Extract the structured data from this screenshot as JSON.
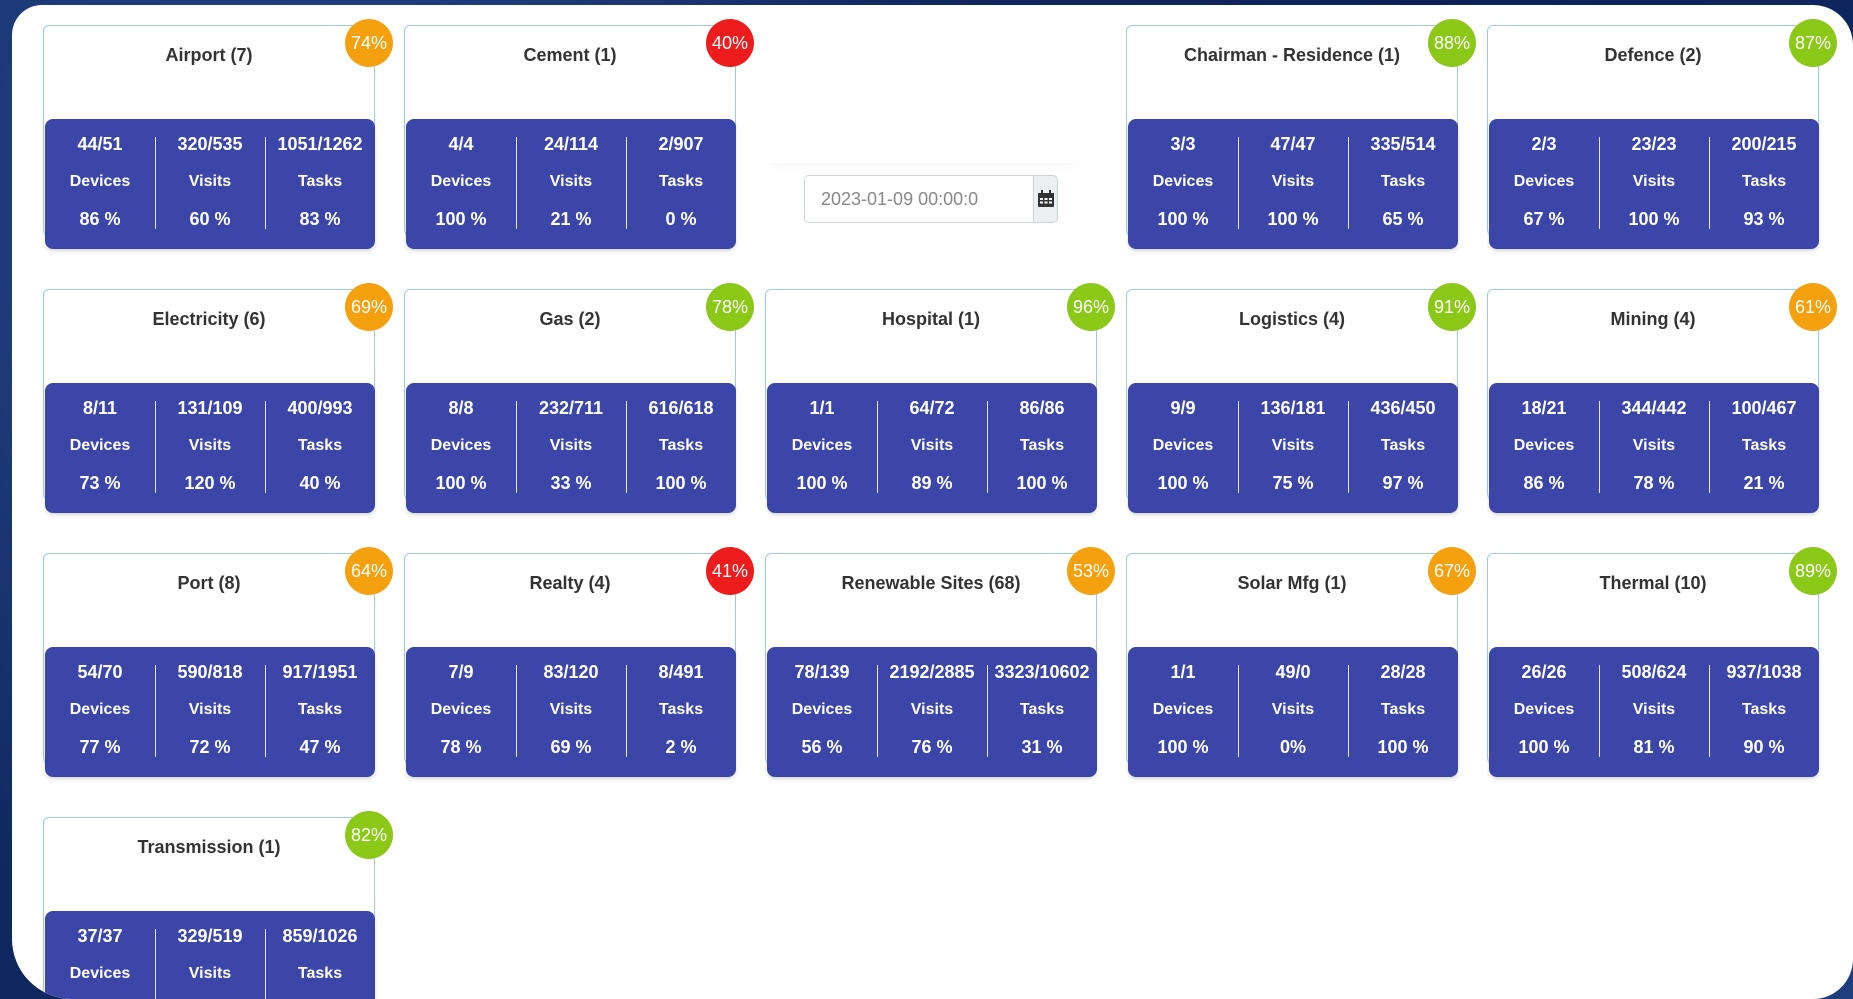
{
  "date_picker": {
    "value": "2023-01-09 00:00:0",
    "icon": "calendar-icon"
  },
  "badge_colors": {
    "orange": "#f5a10f",
    "red": "#ee1c1c",
    "green": "#8cc817"
  },
  "cards": [
    {
      "title": "Airport (7)",
      "badge": "74%",
      "badge_color": "orange",
      "stats": [
        {
          "value": "44/51",
          "label": "Devices",
          "pct": "86 %"
        },
        {
          "value": "320/535",
          "label": "Visits",
          "pct": "60 %"
        },
        {
          "value": "1051/1262",
          "label": "Tasks",
          "pct": "83 %"
        }
      ]
    },
    {
      "title": "Cement (1)",
      "badge": "40%",
      "badge_color": "red",
      "stats": [
        {
          "value": "4/4",
          "label": "Devices",
          "pct": "100 %"
        },
        {
          "value": "24/114",
          "label": "Visits",
          "pct": "21 %"
        },
        {
          "value": "2/907",
          "label": "Tasks",
          "pct": "0 %"
        }
      ]
    },
    {
      "title": "Chairman - Residence (1)",
      "badge": "88%",
      "badge_color": "green",
      "stats": [
        {
          "value": "3/3",
          "label": "Devices",
          "pct": "100 %"
        },
        {
          "value": "47/47",
          "label": "Visits",
          "pct": "100 %"
        },
        {
          "value": "335/514",
          "label": "Tasks",
          "pct": "65 %"
        }
      ]
    },
    {
      "title": "Defence (2)",
      "badge": "87%",
      "badge_color": "green",
      "stats": [
        {
          "value": "2/3",
          "label": "Devices",
          "pct": "67 %"
        },
        {
          "value": "23/23",
          "label": "Visits",
          "pct": "100 %"
        },
        {
          "value": "200/215",
          "label": "Tasks",
          "pct": "93 %"
        }
      ]
    },
    {
      "title": "Electricity (6)",
      "badge": "69%",
      "badge_color": "orange",
      "stats": [
        {
          "value": "8/11",
          "label": "Devices",
          "pct": "73 %"
        },
        {
          "value": "131/109",
          "label": "Visits",
          "pct": "120 %"
        },
        {
          "value": "400/993",
          "label": "Tasks",
          "pct": "40 %"
        }
      ]
    },
    {
      "title": "Gas (2)",
      "badge": "78%",
      "badge_color": "green",
      "stats": [
        {
          "value": "8/8",
          "label": "Devices",
          "pct": "100 %"
        },
        {
          "value": "232/711",
          "label": "Visits",
          "pct": "33 %"
        },
        {
          "value": "616/618",
          "label": "Tasks",
          "pct": "100 %"
        }
      ]
    },
    {
      "title": "Hospital (1)",
      "badge": "96%",
      "badge_color": "green",
      "stats": [
        {
          "value": "1/1",
          "label": "Devices",
          "pct": "100 %"
        },
        {
          "value": "64/72",
          "label": "Visits",
          "pct": "89 %"
        },
        {
          "value": "86/86",
          "label": "Tasks",
          "pct": "100 %"
        }
      ]
    },
    {
      "title": "Logistics (4)",
      "badge": "91%",
      "badge_color": "green",
      "stats": [
        {
          "value": "9/9",
          "label": "Devices",
          "pct": "100 %"
        },
        {
          "value": "136/181",
          "label": "Visits",
          "pct": "75 %"
        },
        {
          "value": "436/450",
          "label": "Tasks",
          "pct": "97 %"
        }
      ]
    },
    {
      "title": "Mining (4)",
      "badge": "61%",
      "badge_color": "orange",
      "stats": [
        {
          "value": "18/21",
          "label": "Devices",
          "pct": "86 %"
        },
        {
          "value": "344/442",
          "label": "Visits",
          "pct": "78 %"
        },
        {
          "value": "100/467",
          "label": "Tasks",
          "pct": "21 %"
        }
      ]
    },
    {
      "title": "Port (8)",
      "badge": "64%",
      "badge_color": "orange",
      "stats": [
        {
          "value": "54/70",
          "label": "Devices",
          "pct": "77 %"
        },
        {
          "value": "590/818",
          "label": "Visits",
          "pct": "72 %"
        },
        {
          "value": "917/1951",
          "label": "Tasks",
          "pct": "47 %"
        }
      ]
    },
    {
      "title": "Realty (4)",
      "badge": "41%",
      "badge_color": "red",
      "stats": [
        {
          "value": "7/9",
          "label": "Devices",
          "pct": "78 %"
        },
        {
          "value": "83/120",
          "label": "Visits",
          "pct": "69 %"
        },
        {
          "value": "8/491",
          "label": "Tasks",
          "pct": "2 %"
        }
      ]
    },
    {
      "title": "Renewable Sites (68)",
      "badge": "53%",
      "badge_color": "orange",
      "stats": [
        {
          "value": "78/139",
          "label": "Devices",
          "pct": "56 %"
        },
        {
          "value": "2192/2885",
          "label": "Visits",
          "pct": "76 %"
        },
        {
          "value": "3323/10602",
          "label": "Tasks",
          "pct": "31 %"
        }
      ]
    },
    {
      "title": "Solar Mfg (1)",
      "badge": "67%",
      "badge_color": "orange",
      "stats": [
        {
          "value": "1/1",
          "label": "Devices",
          "pct": "100 %"
        },
        {
          "value": "49/0",
          "label": "Visits",
          "pct": "0%"
        },
        {
          "value": "28/28",
          "label": "Tasks",
          "pct": "100 %"
        }
      ]
    },
    {
      "title": "Thermal (10)",
      "badge": "89%",
      "badge_color": "green",
      "stats": [
        {
          "value": "26/26",
          "label": "Devices",
          "pct": "100 %"
        },
        {
          "value": "508/624",
          "label": "Visits",
          "pct": "81 %"
        },
        {
          "value": "937/1038",
          "label": "Tasks",
          "pct": "90 %"
        }
      ]
    },
    {
      "title": "Transmission (1)",
      "badge": "82%",
      "badge_color": "green",
      "stats": [
        {
          "value": "37/37",
          "label": "Devices",
          "pct": ""
        },
        {
          "value": "329/519",
          "label": "Visits",
          "pct": ""
        },
        {
          "value": "859/1026",
          "label": "Tasks",
          "pct": ""
        }
      ]
    }
  ]
}
